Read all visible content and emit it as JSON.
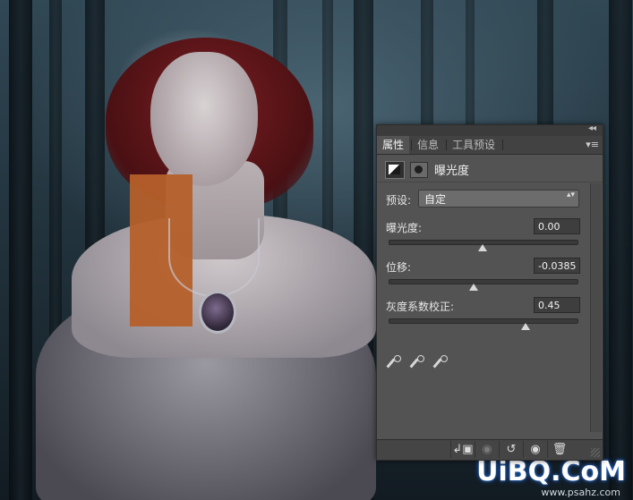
{
  "panel": {
    "tabs": [
      {
        "label": "属性",
        "active": true
      },
      {
        "label": "信息",
        "active": false
      },
      {
        "label": "工具预设",
        "active": false
      }
    ],
    "collapse_glyph": "◂◂",
    "menu_glyph": "▾≡",
    "adjustment_title": "曝光度",
    "preset": {
      "label": "预设:",
      "value": "自定",
      "arrows": "▴▾"
    },
    "params": [
      {
        "label": "曝光度:",
        "value": "0.00",
        "slider_fraction": 0.5
      },
      {
        "label": "位移:",
        "value": "-0.0385",
        "slider_fraction": 0.45
      },
      {
        "label": "灰度系数校正:",
        "value": "0.45",
        "slider_fraction": 0.73
      }
    ],
    "eyedroppers": [
      "black-point-eyedropper",
      "gray-point-eyedropper",
      "white-point-eyedropper"
    ],
    "footer_buttons": [
      {
        "name": "clip-to-layer-icon",
        "glyph": "↲▣",
        "enabled": true
      },
      {
        "name": "view-previous-state-icon",
        "glyph": "◉",
        "enabled": false
      },
      {
        "name": "reset-icon",
        "glyph": "↺",
        "enabled": true
      },
      {
        "name": "visibility-eye-icon",
        "glyph": "◉",
        "enabled": true
      },
      {
        "name": "trash-icon",
        "glyph": "🗑",
        "enabled": true
      }
    ]
  },
  "watermark": {
    "brand": "UiBQ.CoM",
    "sub": "www.psahz.com"
  },
  "colors": {
    "panel_bg": "#535353",
    "tab_bar": "#424242",
    "field_bg": "#3e3e3e",
    "tattoo": "#b5602a",
    "hair": "#7a1e22"
  }
}
